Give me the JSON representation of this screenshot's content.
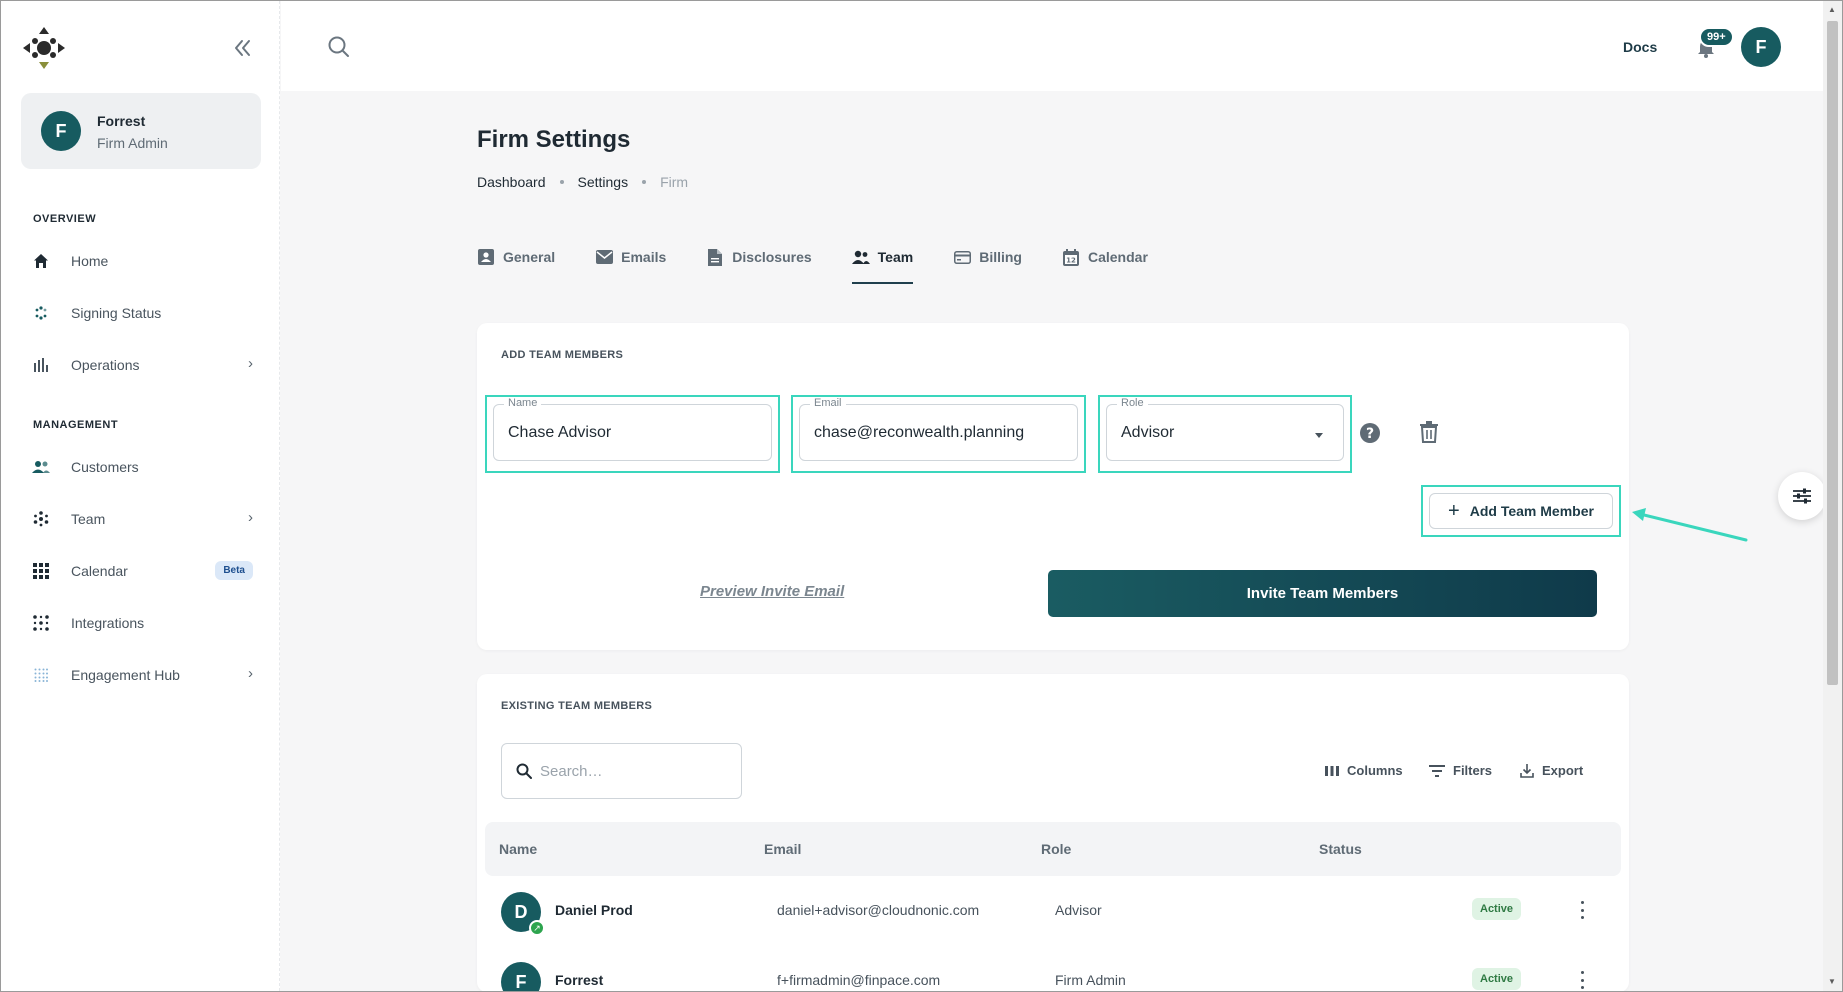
{
  "sidebar": {
    "user": {
      "initial": "F",
      "name": "Forrest",
      "role": "Firm Admin"
    },
    "overview_label": "OVERVIEW",
    "management_label": "MANAGEMENT",
    "overview_items": [
      {
        "label": "Home",
        "icon": "home-icon"
      },
      {
        "label": "Signing Status",
        "icon": "spinner-icon"
      },
      {
        "label": "Operations",
        "icon": "bar-chart-icon"
      }
    ],
    "management_items": [
      {
        "label": "Customers",
        "icon": "users-icon"
      },
      {
        "label": "Team",
        "icon": "team-star-icon"
      },
      {
        "label": "Calendar",
        "icon": "grid-icon",
        "badge": "Beta"
      },
      {
        "label": "Integrations",
        "icon": "dots-icon"
      },
      {
        "label": "Engagement Hub",
        "icon": "dot-grid-icon"
      }
    ]
  },
  "topbar": {
    "docs_label": "Docs",
    "notifications_count": "99+",
    "avatar_initial": "F"
  },
  "page": {
    "title": "Firm Settings",
    "breadcrumb": [
      "Dashboard",
      "Settings",
      "Firm"
    ]
  },
  "tabs": [
    {
      "label": "General",
      "icon": "id-card-icon"
    },
    {
      "label": "Emails",
      "icon": "envelope-icon"
    },
    {
      "label": "Disclosures",
      "icon": "document-icon"
    },
    {
      "label": "Team",
      "icon": "people-icon",
      "active": true
    },
    {
      "label": "Billing",
      "icon": "credit-card-icon"
    },
    {
      "label": "Calendar",
      "icon": "calendar-icon"
    }
  ],
  "add_section": {
    "heading": "ADD TEAM MEMBERS",
    "name_label": "Name",
    "name_value": "Chase Advisor",
    "email_label": "Email",
    "email_value": "chase@reconwealth.planning",
    "role_label": "Role",
    "role_value": "Advisor",
    "add_button": "Add Team Member",
    "preview_link": "Preview Invite Email",
    "invite_button": "Invite Team Members"
  },
  "existing_section": {
    "heading": "EXISTING TEAM MEMBERS",
    "search_placeholder": "Search…",
    "columns_label": "Columns",
    "filters_label": "Filters",
    "export_label": "Export",
    "headers": {
      "name": "Name",
      "email": "Email",
      "role": "Role",
      "status": "Status"
    },
    "rows": [
      {
        "initial": "D",
        "name": "Daniel Prod",
        "email": "daniel+advisor@cloudnonic.com",
        "role": "Advisor",
        "status": "Active"
      },
      {
        "initial": "F",
        "name": "Forrest",
        "email": "f+firmadmin@finpace.com",
        "role": "Firm Admin",
        "status": "Active"
      }
    ]
  },
  "colors": {
    "brand": "#175b60",
    "highlight": "#3ad6bd",
    "invite_gradient_start": "#1a5c62",
    "invite_gradient_end": "#0f3a4a"
  }
}
